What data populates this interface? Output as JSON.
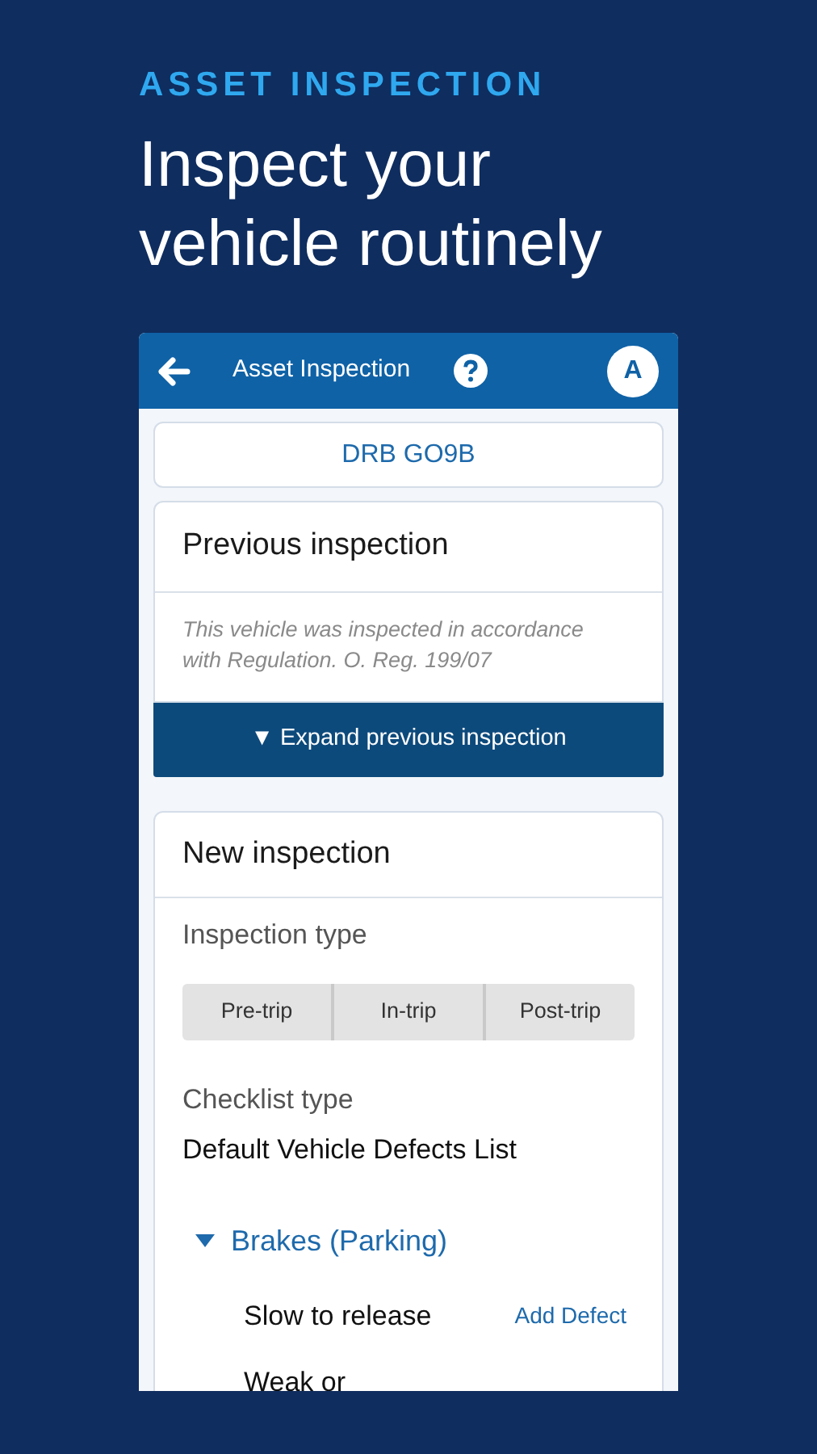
{
  "promo": {
    "eyebrow": "ASSET INSPECTION",
    "headline": "Inspect your vehicle routinely"
  },
  "app_bar": {
    "title": "Asset Inspection",
    "avatar": "A"
  },
  "vehicle": "DRB GO9B",
  "previous_inspection": {
    "title": "Previous inspection",
    "note": "This vehicle was inspected in accordance with Regulation. O. Reg. 199/07",
    "expand_button": {
      "glyph": "▼",
      "label": "Expand previous inspection"
    }
  },
  "new_inspection": {
    "title": "New inspection",
    "inspection_type_label": "Inspection type",
    "inspection_types": [
      {
        "label": "Pre-trip",
        "selected": false
      },
      {
        "label": "In-trip",
        "selected": false
      },
      {
        "label": "Post-trip",
        "selected": false
      }
    ],
    "checklist_type_label": "Checklist type",
    "checklist_type": "Default Vehicle Defects List",
    "groups": [
      {
        "name": "Brakes (Parking)",
        "expanded": true,
        "items": [
          {
            "label": "Slow to release",
            "action": "Add Defect"
          },
          {
            "label": "Weak or"
          }
        ]
      }
    ]
  }
}
